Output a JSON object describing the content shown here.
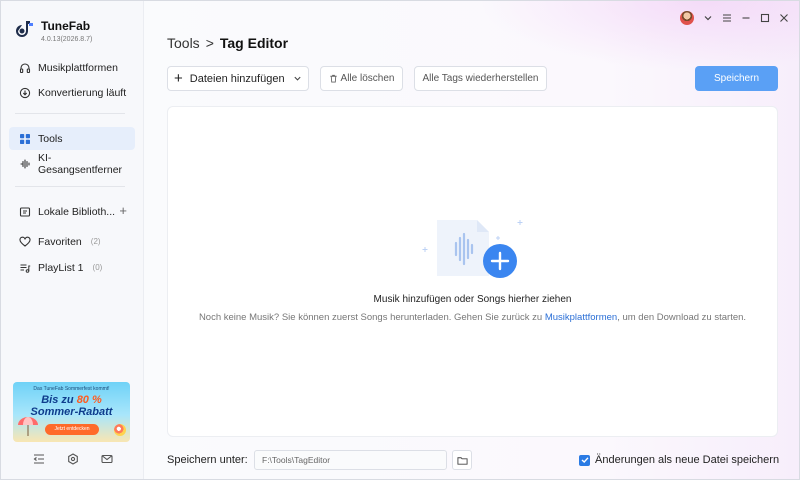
{
  "app": {
    "name": "TuneFab",
    "version": "4.0.13(2026.8.7)"
  },
  "sidebar": {
    "items": [
      {
        "label": "Musikplattformen",
        "icon": "headphones-icon"
      },
      {
        "label": "Konvertierung läuft",
        "icon": "convert-icon"
      },
      {
        "label": "Tools",
        "icon": "grid-icon",
        "active": true
      },
      {
        "label": "KI-Gesangsentferner",
        "icon": "voice-icon"
      }
    ],
    "library": {
      "label": "Lokale Biblioth...",
      "add_label": "+"
    },
    "favorites": {
      "label": "Favoriten",
      "count": "(2)"
    },
    "playlist": {
      "label": "PlayList 1",
      "count": "(0)"
    },
    "promo": {
      "top_text": "Das TuneFab Sommerfest kommt!",
      "line1_prefix": "Bis zu ",
      "line1_highlight": "80 %",
      "line2": "Sommer-Rabatt",
      "cta": "Jetzt entdecken"
    }
  },
  "header": {
    "breadcrumb_root": "Tools",
    "breadcrumb_separator": ">",
    "breadcrumb_current": "Tag Editor"
  },
  "toolbar": {
    "add_files": "Dateien hinzufügen",
    "clear_all": "Alle löschen",
    "restore_tags": "Alle Tags wiederherstellen",
    "save": "Speichern"
  },
  "dropzone": {
    "title": "Musik hinzufügen oder Songs hierher ziehen",
    "sub_before": "Noch keine Musik? Sie können zuerst Songs herunterladen. Gehen Sie zurück zu ",
    "sub_link": "Musikplattformen",
    "sub_after": ", um den Download zu starten."
  },
  "footer": {
    "save_under_label": "Speichern unter:",
    "path_value": "F:\\Tools\\TagEditor",
    "checkbox_label": "Änderungen als neue Datei speichern",
    "checkbox_checked": true
  },
  "colors": {
    "accent": "#5aa0f5",
    "link": "#2b6fd6",
    "active_bg": "#e6eefb"
  }
}
